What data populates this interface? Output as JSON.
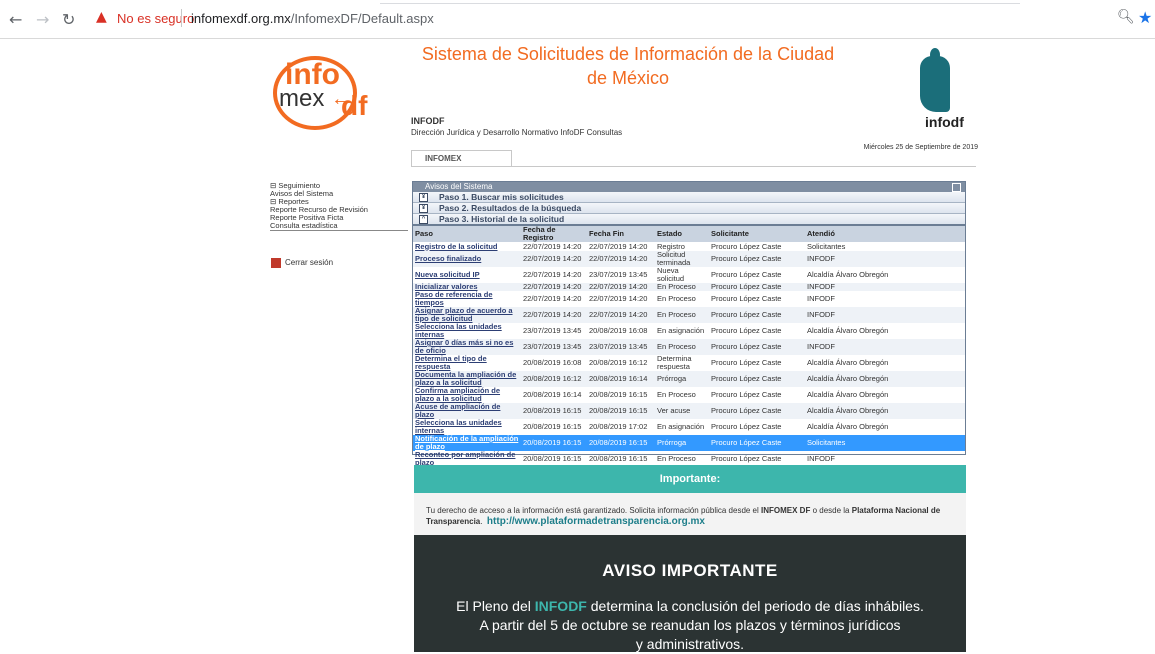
{
  "browser": {
    "security_label": "No es seguro",
    "url_domain": "infomexdf.org.mx",
    "url_path": "/InfomexDF/Default.aspx"
  },
  "header": {
    "logo_info": "info",
    "logo_mex": "mex",
    "logo_df": "df",
    "title": "Sistema de Solicitudes de Información de la Ciudad de México",
    "org": "INFODF",
    "dept": "Dirección Jurídica y Desarrollo Normativo InfoDF Consultas",
    "date": "Miércoles 25 de Septiembre de 2019",
    "brand": "infodf",
    "tab": "INFOMEX"
  },
  "menu": {
    "items": [
      "⊟ Seguimiento",
      "Avisos del Sistema",
      "⊟ Reportes",
      "Reporte Recurso de Revisión",
      "Reporte Positiva Ficta",
      "Consulta estadística"
    ],
    "logout": "Cerrar sesión"
  },
  "panel": {
    "title": "Avisos del Sistema",
    "step1": "Paso 1. Buscar mis solicitudes",
    "step2": "Paso 2. Resultados de la búsqueda",
    "step3": "Paso 3. Historial de la solicitud",
    "headers": [
      "Paso",
      "Fecha de Registro",
      "Fecha Fin",
      "Estado",
      "Solicitante",
      "Atendió"
    ],
    "rows": [
      [
        "Registro de la solicitud",
        "22/07/2019 14:20",
        "22/07/2019 14:20",
        "Registro",
        "Procuro López Caste",
        "Solicitantes"
      ],
      [
        "Proceso finalizado",
        "22/07/2019 14:20",
        "22/07/2019 14:20",
        "Solicitud terminada",
        "Procuro López Caste",
        "INFODF"
      ],
      [
        "Nueva solicitud IP",
        "22/07/2019 14:20",
        "23/07/2019 13:45",
        "Nueva solicitud",
        "Procuro López Caste",
        "Alcaldía Álvaro Obregón"
      ],
      [
        "Inicializar valores",
        "22/07/2019 14:20",
        "22/07/2019 14:20",
        "En Proceso",
        "Procuro López Caste",
        "INFODF"
      ],
      [
        "Paso de referencia de tiempos",
        "22/07/2019 14:20",
        "22/07/2019 14:20",
        "En Proceso",
        "Procuro López Caste",
        "INFODF"
      ],
      [
        "Asignar plazo de acuerdo a tipo de solicitud",
        "22/07/2019 14:20",
        "22/07/2019 14:20",
        "En Proceso",
        "Procuro López Caste",
        "INFODF"
      ],
      [
        "Selecciona las unidades internas",
        "23/07/2019 13:45",
        "20/08/2019 16:08",
        "En asignación",
        "Procuro López Caste",
        "Alcaldía Álvaro Obregón"
      ],
      [
        "Asignar 0 días más si no es de oficio",
        "23/07/2019 13:45",
        "23/07/2019 13:45",
        "En Proceso",
        "Procuro López Caste",
        "INFODF"
      ],
      [
        "Determina el tipo de respuesta",
        "20/08/2019 16:08",
        "20/08/2019 16:12",
        "Determina respuesta",
        "Procuro López Caste",
        "Alcaldía Álvaro Obregón"
      ],
      [
        "Documenta la ampliación de plazo a la solicitud",
        "20/08/2019 16:12",
        "20/08/2019 16:14",
        "Prórroga",
        "Procuro López Caste",
        "Alcaldía Álvaro Obregón"
      ],
      [
        "Confirma ampliación de plazo a la solicitud",
        "20/08/2019 16:14",
        "20/08/2019 16:15",
        "En Proceso",
        "Procuro López Caste",
        "Alcaldía Álvaro Obregón"
      ],
      [
        "Acuse de ampliación de plazo",
        "20/08/2019 16:15",
        "20/08/2019 16:15",
        "Ver acuse",
        "Procuro López Caste",
        "Alcaldía Álvaro Obregón"
      ],
      [
        "Selecciona las unidades internas",
        "20/08/2019 16:15",
        "20/08/2019 17:02",
        "En asignación",
        "Procuro López Caste",
        "Alcaldía Álvaro Obregón"
      ],
      [
        "Notificación de la ampliación de plazo",
        "20/08/2019 16:15",
        "20/08/2019 16:15",
        "Prórroga",
        "Procuro López Caste",
        "Solicitantes"
      ],
      [
        "Reconteo por ampliación de plazo",
        "20/08/2019 16:15",
        "20/08/2019 16:15",
        "En Proceso",
        "Procuro López Caste",
        "INFODF"
      ]
    ],
    "selected_row": 13
  },
  "importante": {
    "title": "Importante:",
    "text_1": "Tu derecho de acceso a la información está garantizado. Solicita información pública desde el ",
    "text_bold_1": "INFOMEX DF",
    "text_2": " o desde la ",
    "text_bold_2": "Plataforma Nacional de Transparencia",
    "link": "http://www.plataformadetransparencia.org.mx"
  },
  "aviso": {
    "title": "AVISO IMPORTANTE",
    "line1_a": "El Pleno del ",
    "line1_hl": "INFODF",
    "line1_b": " determina la conclusión del periodo de días inhábiles.",
    "line2": "A partir del 5 de octubre se reanudan los plazos y términos jurídicos",
    "line3": "y administrativos."
  }
}
